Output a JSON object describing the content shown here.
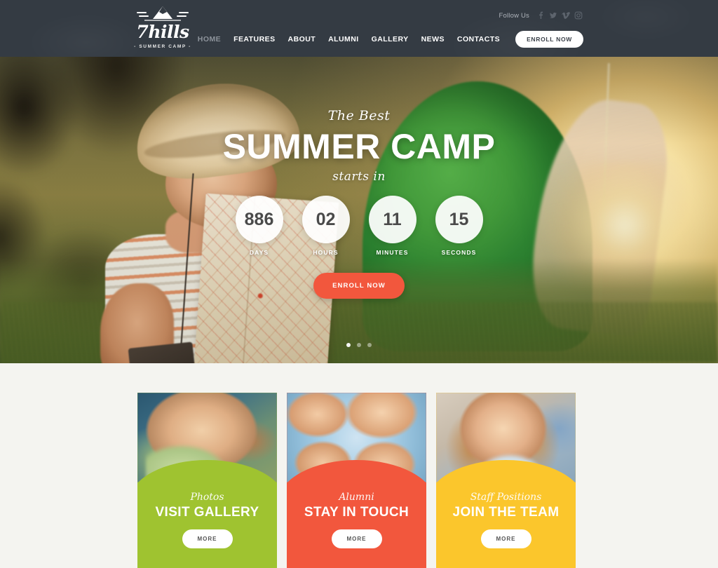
{
  "header": {
    "logo": {
      "word": "7hills",
      "subtitle": "- SUMMER CAMP -",
      "icon": "mountain-peak-icon"
    },
    "follow": {
      "label": "Follow Us",
      "icons": [
        "facebook-icon",
        "twitter-icon",
        "vimeo-icon",
        "instagram-icon"
      ]
    },
    "nav": [
      {
        "label": "HOME",
        "active": false
      },
      {
        "label": "FEATURES",
        "active": true
      },
      {
        "label": "ABOUT",
        "active": true
      },
      {
        "label": "ALUMNI",
        "active": true
      },
      {
        "label": "GALLERY",
        "active": true
      },
      {
        "label": "NEWS",
        "active": true
      },
      {
        "label": "CONTACTS",
        "active": true
      }
    ],
    "enroll_button": "ENROLL NOW"
  },
  "hero": {
    "eyebrow": "The Best",
    "title": "SUMMER CAMP",
    "subtitle": "starts in",
    "countdown": [
      {
        "value": "886",
        "label": "DAYS"
      },
      {
        "value": "02",
        "label": "HOURS"
      },
      {
        "value": "11",
        "label": "MINUTES"
      },
      {
        "value": "15",
        "label": "SECONDS"
      }
    ],
    "cta": "ENROLL NOW",
    "slider_dots": 3,
    "active_dot": 0
  },
  "cards": [
    {
      "script": "Photos",
      "title": "VISIT GALLERY",
      "more": "MORE",
      "color": "#9fc330"
    },
    {
      "script": "Alumni",
      "title": "STAY IN TOUCH",
      "more": "MORE",
      "color": "#f2573d"
    },
    {
      "script": "Staff Positions",
      "title": "JOIN THE TEAM",
      "more": "MORE",
      "color": "#fbc62c"
    }
  ],
  "colors": {
    "header_bg": "#343b43",
    "accent_orange": "#f2573d",
    "accent_green": "#9fc330",
    "accent_yellow": "#fbc62c",
    "page_bg": "#f4f4f0"
  }
}
